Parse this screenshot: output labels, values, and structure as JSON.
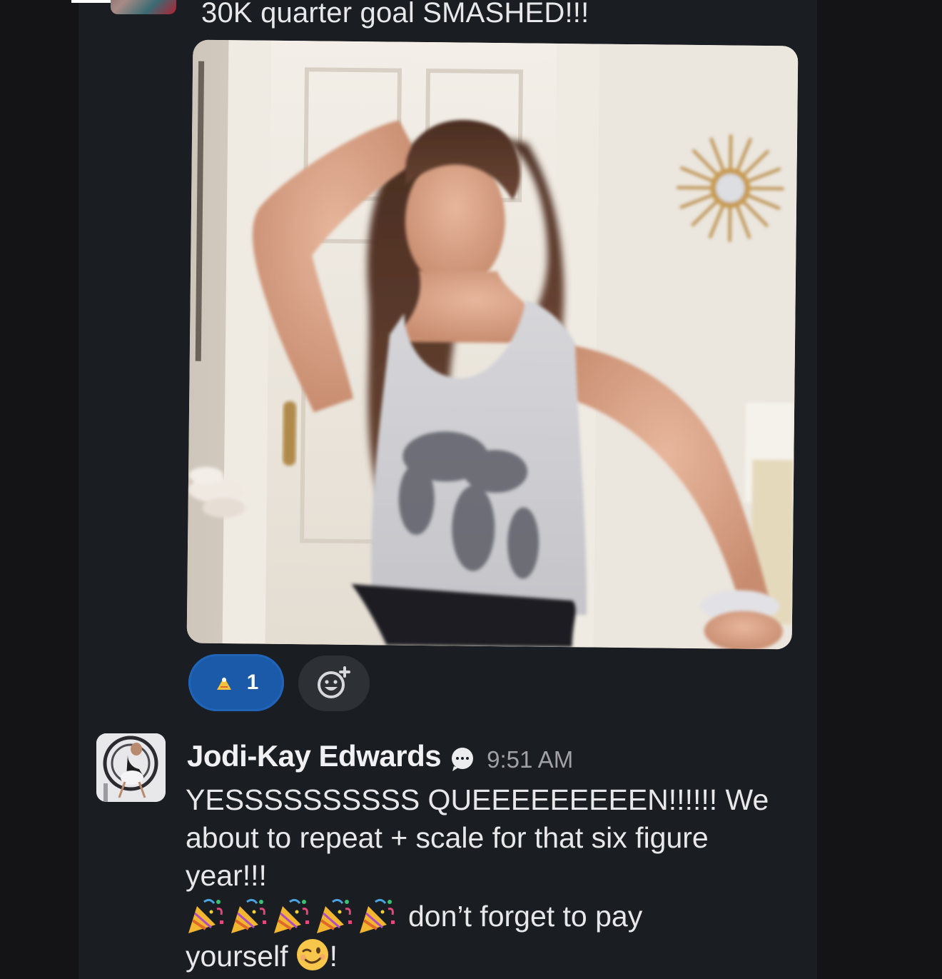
{
  "previous_message": {
    "text": "30K quarter goal SMASHED!!!"
  },
  "gif": {
    "alt": "animated gif"
  },
  "reactions": [
    {
      "emoji": "celebration-emoji-icon",
      "count": "1",
      "selected": true
    }
  ],
  "add_reaction": {
    "icon": "add-reaction-icon"
  },
  "message": {
    "author": "Jodi-Kay Edwards",
    "status_icon": "speech-bubble-icon",
    "timestamp": "9:51 AM",
    "lines": [
      "YESSSSSSSSSS QUEEEEEEEEEN!!!!!! We",
      "about to repeat + scale for that six figure",
      "year!!!"
    ],
    "emoji_line_text": "don’t forget to pay",
    "last_line_text": "yourself",
    "last_line_suffix": "!",
    "emojis": [
      "party-popper-icon",
      "party-popper-icon",
      "party-popper-icon",
      "party-popper-icon",
      "party-popper-icon"
    ],
    "wink_emoji": "winking-face-icon"
  },
  "colors": {
    "background": "#1a1d21",
    "reaction_selected": "#1b5aa8",
    "add_reaction_bg": "#2d3034",
    "timestamp": "#a0a0a6"
  }
}
